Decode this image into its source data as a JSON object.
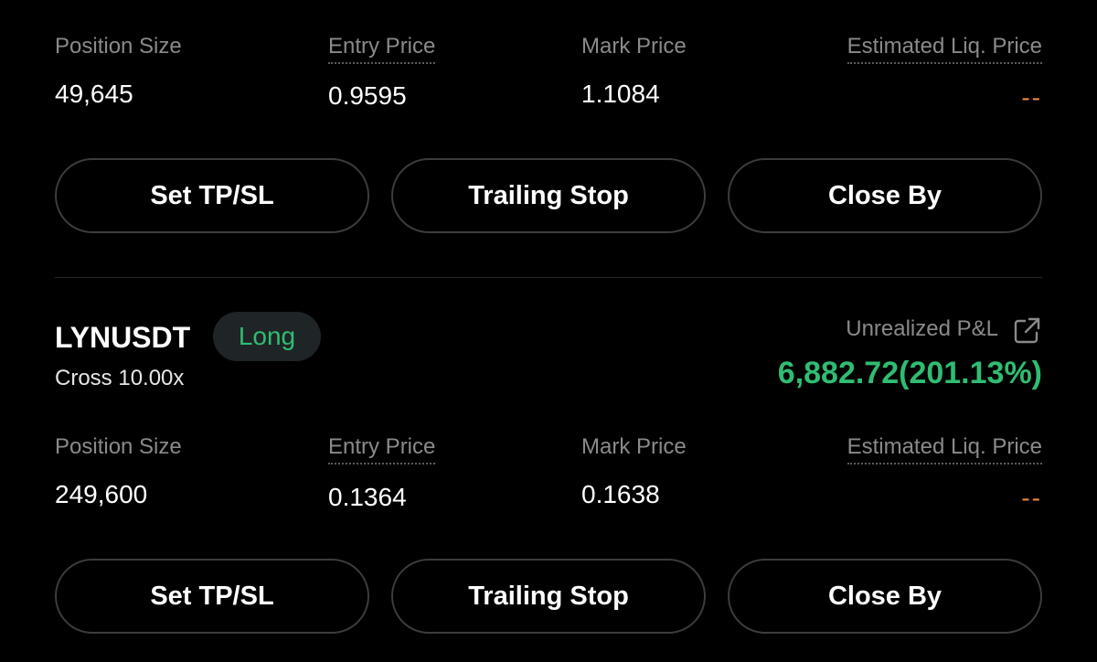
{
  "labels": {
    "position_size": "Position Size",
    "entry_price": "Entry Price",
    "mark_price": "Mark Price",
    "est_liq_price": "Estimated Liq. Price",
    "unrealized_pnl": "Unrealized P&L"
  },
  "buttons": {
    "set_tpsl": "Set TP/SL",
    "trailing_stop": "Trailing Stop",
    "close_by": "Close By"
  },
  "positions": [
    {
      "position_size": "49,645",
      "entry_price": "0.9595",
      "mark_price": "1.1084",
      "est_liq_price": "--"
    },
    {
      "symbol": "LYNUSDT",
      "side": "Long",
      "margin": "Cross 10.00x",
      "unrealized_pnl": "6,882.72(201.13%)",
      "position_size": "249,600",
      "entry_price": "0.1364",
      "mark_price": "0.1638",
      "est_liq_price": "--"
    }
  ],
  "colors": {
    "background": "#000000",
    "profit_green": "#2fbd72",
    "liq_orange": "#e8883a"
  },
  "icons": {
    "share": "external-link-icon"
  }
}
